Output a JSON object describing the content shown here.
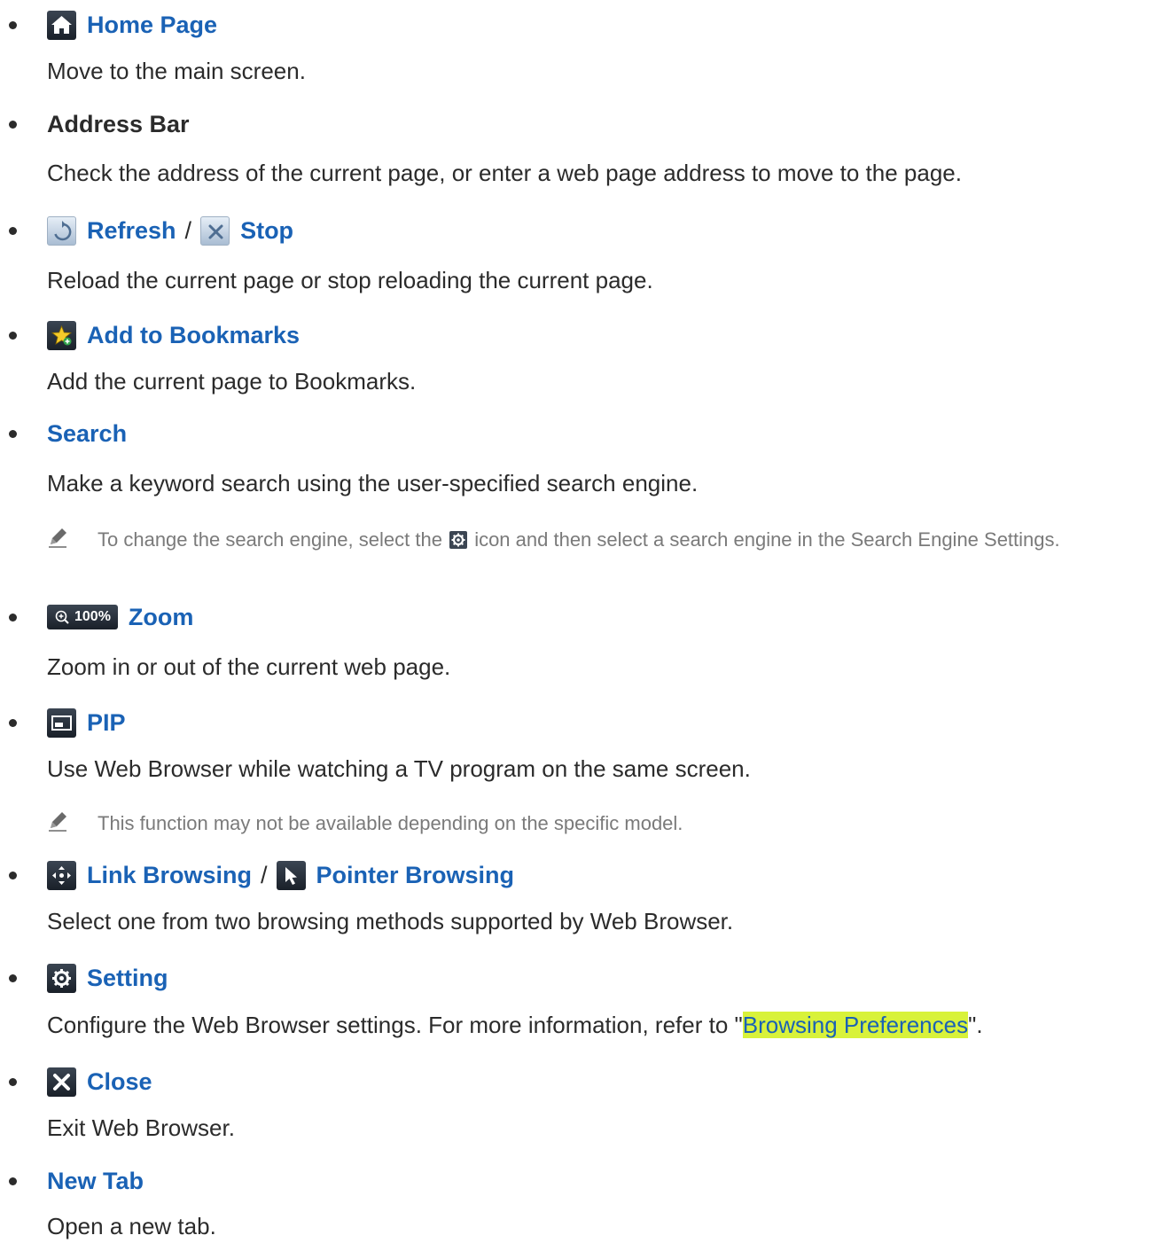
{
  "items": [
    {
      "title": "Home Page",
      "icon": "home-icon",
      "desc": "Move to the main screen."
    },
    {
      "title": "Address Bar",
      "desc": "Check the address of the current page, or enter a web page address to move to the page."
    },
    {
      "title_a": "Refresh",
      "icon_a": "refresh-icon",
      "separator": "/",
      "title_b": "Stop",
      "icon_b": "stop-icon",
      "desc": "Reload the current page or stop reloading the current page."
    },
    {
      "title": "Add to Bookmarks",
      "icon": "bookmark-star-icon",
      "desc": "Add the current page to Bookmarks."
    },
    {
      "title": "Search",
      "desc": "Make a keyword search using the user-specified search engine.",
      "note_before_icon": "To change the search engine, select the",
      "note_icon": "gear-icon",
      "note_after_icon": "icon and then select a search engine in the Search Engine Settings."
    },
    {
      "title": "Zoom",
      "badge": "100%",
      "icon": "zoom-in-icon",
      "desc": "Zoom in or out of the current web page."
    },
    {
      "title": "PIP",
      "icon": "pip-icon",
      "desc": "Use Web Browser while watching a TV program on the same screen.",
      "note": "This function may not be available depending on the specific model."
    },
    {
      "title_a": "Link Browsing",
      "icon_a": "link-browsing-icon",
      "separator": "/",
      "title_b": "Pointer Browsing",
      "icon_b": "pointer-icon",
      "desc": "Select one from two browsing methods supported by Web Browser."
    },
    {
      "title": "Setting",
      "icon": "settings-gear-icon",
      "desc_before": "Configure the Web Browser settings. For more information, refer to \"",
      "desc_link": "Browsing Preferences",
      "desc_after": "\"."
    },
    {
      "title": "Close",
      "icon": "close-icon",
      "desc": "Exit Web Browser."
    },
    {
      "title": "New Tab",
      "desc": "Open a new tab."
    }
  ],
  "colors": {
    "link": "#1a62b5",
    "text": "#2b2b2b",
    "note": "#7a7a7a",
    "highlight": "#d8f23a"
  }
}
